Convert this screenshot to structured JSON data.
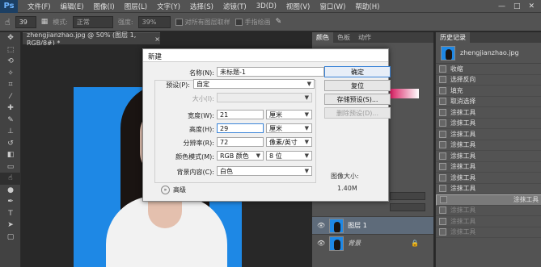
{
  "app": {
    "logo": "Ps"
  },
  "menu": [
    "文件(F)",
    "编辑(E)",
    "图像(I)",
    "图层(L)",
    "文字(Y)",
    "选择(S)",
    "滤镜(T)",
    "3D(D)",
    "视图(V)",
    "窗口(W)",
    "帮助(H)"
  ],
  "window_controls": [
    "—",
    "□",
    "✕"
  ],
  "options_bar": {
    "size": "39",
    "mode_label": "模式:",
    "mode_value": "正常",
    "opacity_label": "强度:",
    "opacity_value": "39%",
    "sample_all_label": "对所有图层取样",
    "finger_paint_label": "手指绘画"
  },
  "document": {
    "tab_title": "zhengjianzhao.jpg @ 50% (图层 1, RGB/8#) *",
    "close": "×"
  },
  "dialog": {
    "title": "新建",
    "name_label": "名称(N):",
    "name_value": "未标题-1",
    "preset_label": "预设(P):",
    "preset_value": "自定",
    "size_label": "大小(I):",
    "size_value": "",
    "width_label": "宽度(W):",
    "width_value": "21",
    "width_unit": "厘米",
    "height_label": "高度(H):",
    "height_value": "29",
    "height_unit": "厘米",
    "resolution_label": "分辨率(R):",
    "resolution_value": "72",
    "resolution_unit": "像素/英寸",
    "color_mode_label": "颜色模式(M):",
    "color_mode_value": "RGB 颜色",
    "bit_depth": "8 位",
    "background_label": "背景内容(C):",
    "background_value": "白色",
    "advanced_label": "高级",
    "ok_button": "确定",
    "reset_button": "复位",
    "save_preset_button": "存储预设(S)...",
    "delete_preset_button": "删除预设(D)...",
    "image_size_label": "图像大小:",
    "image_size_value": "1.40M"
  },
  "color_panel": {
    "tabs": [
      "颜色",
      "色板",
      "动作"
    ]
  },
  "layers": [
    {
      "name": "图层 1"
    },
    {
      "name": "背景"
    }
  ],
  "history": {
    "tab": "历史记录",
    "snapshot": "zhengjianzhao.jpg",
    "items": [
      "收缩",
      "选择反向",
      "填充",
      "取消选择",
      "涂抹工具",
      "涂抹工具",
      "涂抹工具",
      "涂抹工具",
      "涂抹工具",
      "涂抹工具",
      "涂抹工具",
      "涂抹工具",
      "涂抹工具",
      "涂抹工具",
      "涂抹工具",
      "涂抹工具"
    ],
    "selected_index": 12,
    "greyed_from": 13
  },
  "colors": {
    "accent": "#3a84d8",
    "photo_bg": "#1e88e5",
    "panel": "#535353",
    "ps_blue": "#1c3f63"
  }
}
